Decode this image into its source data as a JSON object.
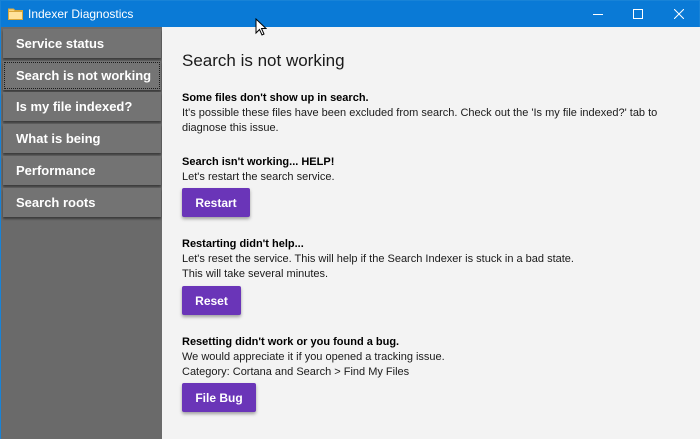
{
  "window": {
    "title": "Indexer Diagnostics",
    "accent_color": "#0a7ad6",
    "icons": [
      "app-icon",
      "minimize-icon",
      "maximize-icon",
      "close-icon"
    ]
  },
  "sidebar": {
    "items": [
      {
        "label": "Service status"
      },
      {
        "label": "Search is not working",
        "selected": true
      },
      {
        "label": "Is my file indexed?"
      },
      {
        "label": "What is being indexed?"
      },
      {
        "label": "Performance"
      },
      {
        "label": "Search roots"
      }
    ]
  },
  "main": {
    "title": "Search is not working",
    "sections": [
      {
        "heading": "Some files don't show up in search.",
        "lines": [
          "It's possible these files have been excluded from search. Check out the 'Is my file indexed?' tab to",
          "diagnose this issue."
        ]
      },
      {
        "heading": "Search isn't working... HELP!",
        "lines": [
          "Let's restart the search service."
        ],
        "button": "Restart"
      },
      {
        "heading": "Restarting didn't help...",
        "lines": [
          "Let's reset the service. This will help if the Search Indexer is stuck in a bad state.",
          "This will take several minutes."
        ],
        "button": "Reset"
      },
      {
        "heading": "Resetting didn't work or you found a bug.",
        "lines": [
          "We would appreciate it if you opened a tracking issue.",
          "Category: Cortana and Search > Find My Files"
        ],
        "button": "File Bug"
      }
    ]
  },
  "colors": {
    "sidebar_bg": "#6a6a6a",
    "button_bg": "#6a35b8",
    "content_bg": "#f3f3f3"
  }
}
